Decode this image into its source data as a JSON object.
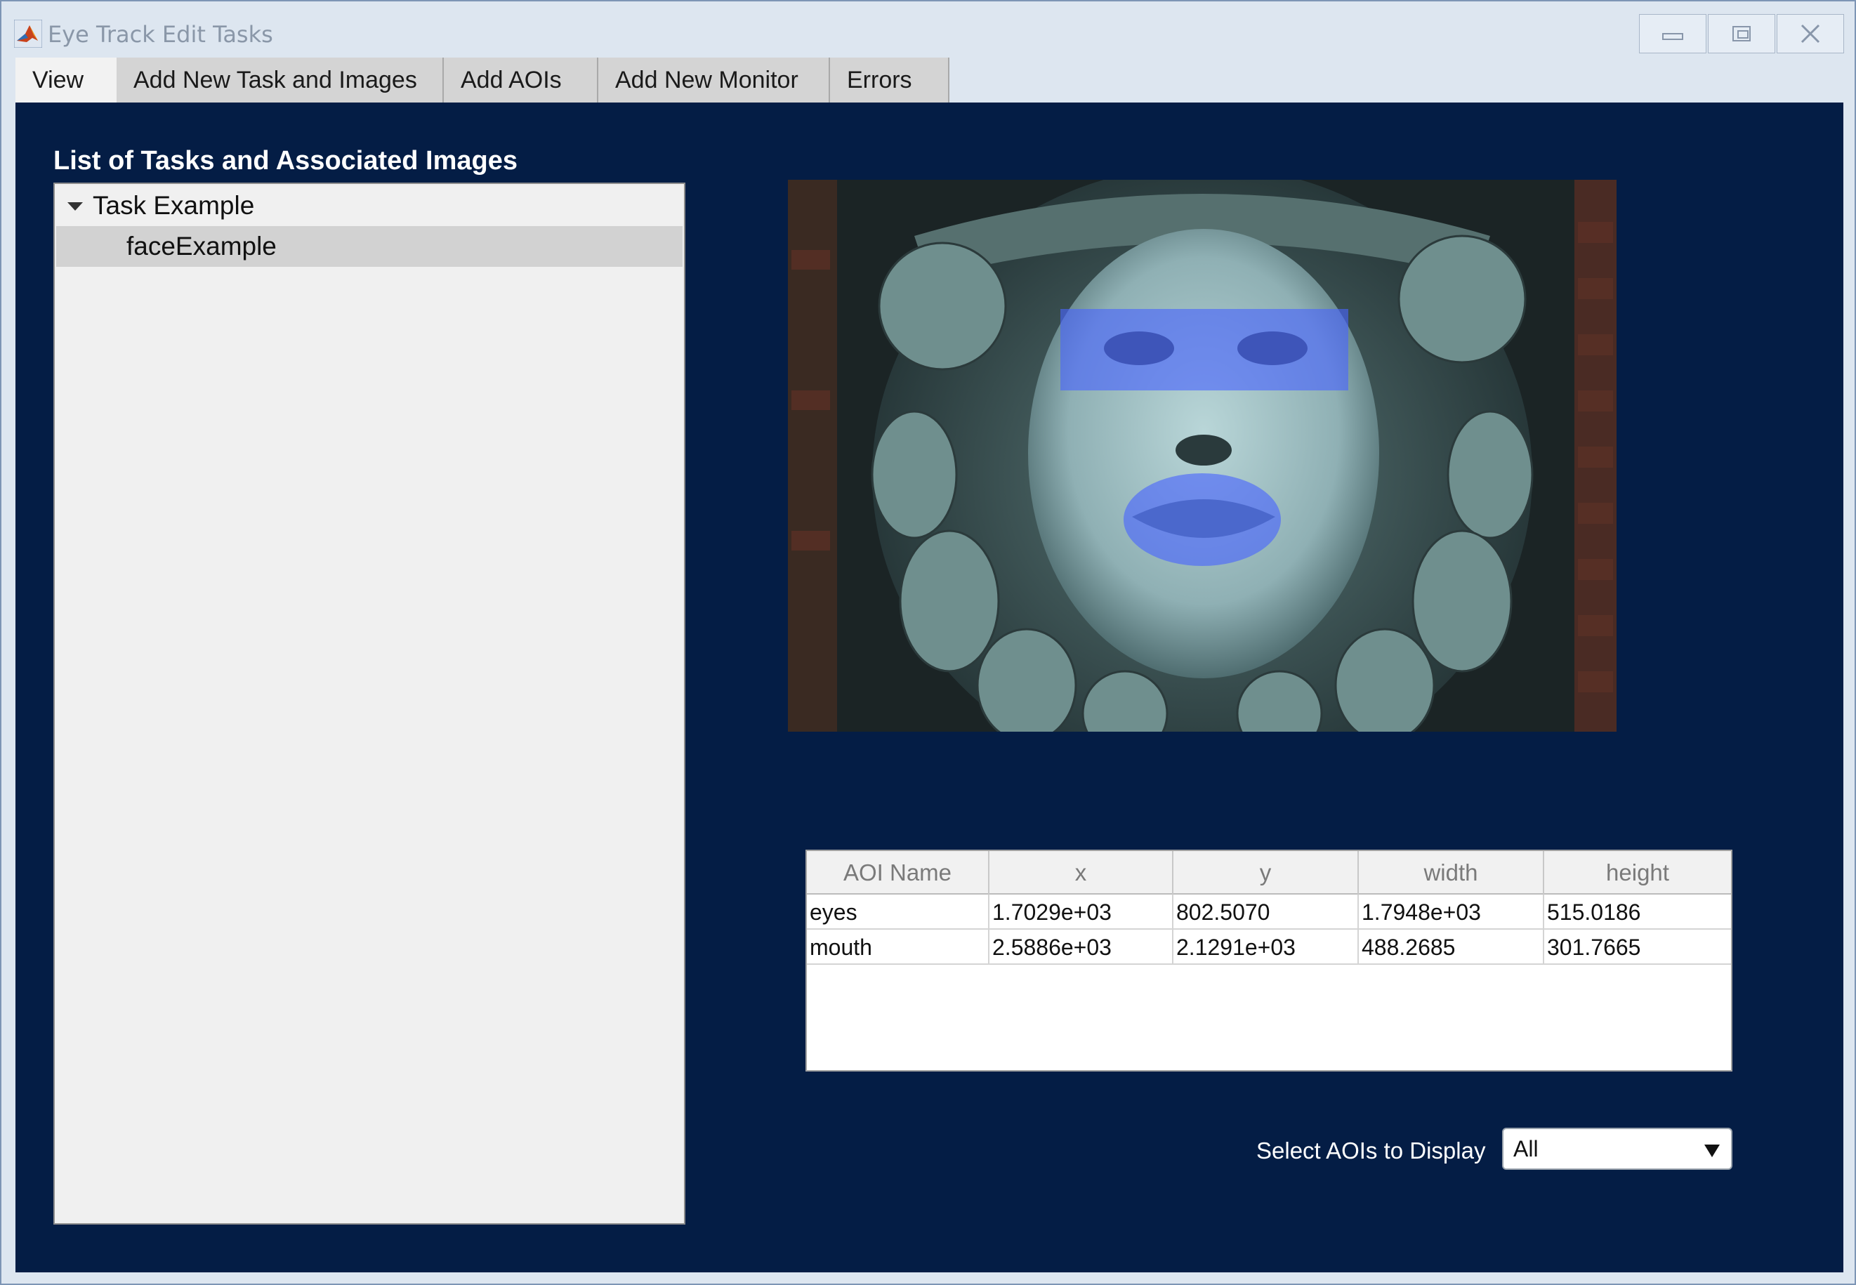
{
  "window": {
    "title": "Eye Track Edit Tasks",
    "icon": "matlab-icon"
  },
  "tabs": [
    {
      "label": "View",
      "active": true
    },
    {
      "label": "Add New Task and Images",
      "active": false
    },
    {
      "label": "Add AOIs",
      "active": false
    },
    {
      "label": "Add New Monitor",
      "active": false
    },
    {
      "label": "Errors",
      "active": false
    }
  ],
  "tree": {
    "heading": "List of Tasks and Associated Images",
    "nodes": [
      {
        "label": "Task Example",
        "expanded": true,
        "children": [
          {
            "label": "faceExample",
            "selected": true
          }
        ]
      }
    ]
  },
  "image": {
    "description_icon": "face-statue-image",
    "aois": [
      "eyes",
      "mouth"
    ]
  },
  "aoi_table": {
    "columns": [
      "AOI Name",
      "x",
      "y",
      "width",
      "height"
    ],
    "rows": [
      [
        "eyes",
        "1.7029e+03",
        "802.5070",
        "1.7948e+03",
        "515.0186"
      ],
      [
        "mouth",
        "2.5886e+03",
        "2.1291e+03",
        "488.2685",
        "301.7665"
      ]
    ]
  },
  "aoi_selector": {
    "label": "Select AOIs to Display",
    "value": "All"
  },
  "colors": {
    "panel_background": "#041d45",
    "aoi_overlay": "#4864ff"
  }
}
